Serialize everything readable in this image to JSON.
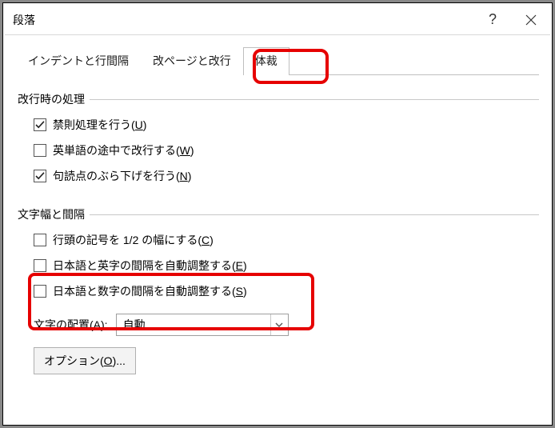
{
  "titlebar": {
    "title": "段落"
  },
  "tabs": {
    "indent": "インデントと行間隔",
    "pagebreak": "改ページと改行",
    "typography": "体裁"
  },
  "group1": {
    "title": "改行時の処理",
    "chk_kinsoku_label": "禁則処理を行う(",
    "chk_kinsoku_accel": "U",
    "chk_kinsoku_close": ")",
    "chk_eiword_label": "英単語の途中で改行する(",
    "chk_eiword_accel": "W",
    "chk_eiword_close": ")",
    "chk_kutou_label": "句読点のぶら下げを行う(",
    "chk_kutou_accel": "N",
    "chk_kutou_close": ")"
  },
  "group2": {
    "title": "文字幅と間隔",
    "chk_half_label": "行頭の記号を 1/2 の幅にする(",
    "chk_half_accel": "C",
    "chk_half_close": ")",
    "chk_jpn_eng_label": "日本語と英字の間隔を自動調整する(",
    "chk_jpn_eng_accel": "E",
    "chk_jpn_eng_close": ")",
    "chk_jpn_num_label": "日本語と数字の間隔を自動調整する(",
    "chk_jpn_num_accel": "S",
    "chk_jpn_num_close": ")",
    "align_label_pre": "文字の配置(",
    "align_accel": "A",
    "align_label_post": "):",
    "align_value": "自動",
    "options_label_pre": "オプション(",
    "options_accel": "O",
    "options_label_post": ")..."
  }
}
